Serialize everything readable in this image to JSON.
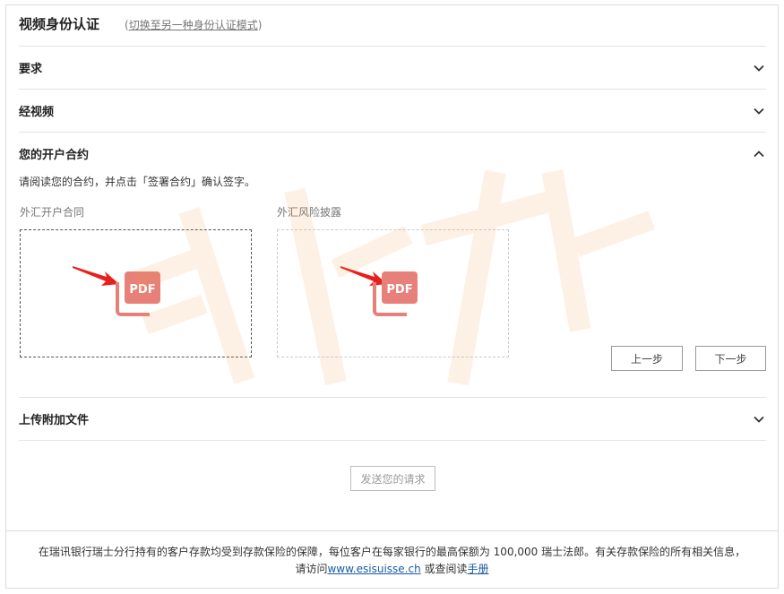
{
  "header": {
    "title": "视频身份认证",
    "switch_link": "切换至另一种身份认证模式"
  },
  "sections": {
    "requirements": {
      "title": "要求"
    },
    "video": {
      "title": "经视频"
    },
    "contract": {
      "title": "您的开户合约",
      "instruction": "请阅读您的合约，并点击「签署合约」确认签字。",
      "doc1_label": "外汇开户合同",
      "doc2_label": "外汇风险披露",
      "prev_label": "上一步",
      "next_label": "下一步"
    },
    "upload": {
      "title": "上传附加文件"
    }
  },
  "actions": {
    "send_label": "发送您的请求"
  },
  "footer": {
    "line1": "在瑞讯银行瑞士分行持有的客户存款均受到存款保险的保障，每位客户在每家银行的最高保额为 100,000 瑞士法郎。有关存款保险的所有相关信息，",
    "line2_prefix": "请访问",
    "link_site": "www.esisuisse.ch",
    "line2_middle": " 或查阅读",
    "link_manual": "手册"
  },
  "icons": {
    "pdf": "pdf-icon",
    "chevron_down": "chevron-down-icon",
    "chevron_up": "chevron-up-icon",
    "arrow": "red-arrow-icon"
  },
  "colors": {
    "pdf": "#e8807a",
    "arrow": "#e8201c",
    "link": "#1a5aa6"
  }
}
